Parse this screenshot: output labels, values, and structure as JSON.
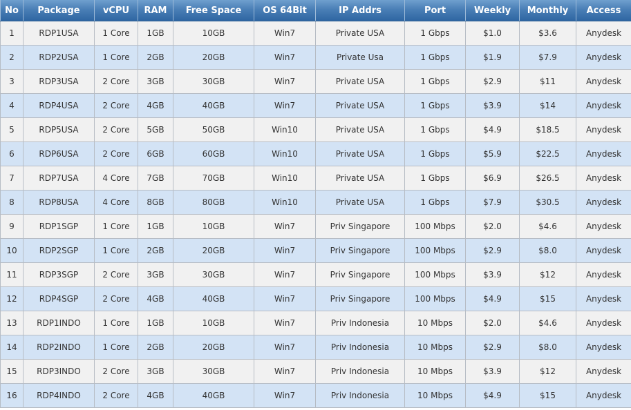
{
  "colors": {
    "header_bg": "#4a7fb6",
    "header_text": "#ffffff",
    "row_odd": "#f1f1f1",
    "row_even": "#d3e3f5",
    "border": "#b6bcc4"
  },
  "table": {
    "headers": [
      "No",
      "Package",
      "vCPU",
      "RAM",
      "Free Space",
      "OS 64Bit",
      "IP Addrs",
      "Port",
      "Weekly",
      "Monthly",
      "Access"
    ],
    "rows": [
      [
        "1",
        "RDP1USA",
        "1 Core",
        "1GB",
        "10GB",
        "Win7",
        "Private USA",
        "1 Gbps",
        "$1.0",
        "$3.6",
        "Anydesk"
      ],
      [
        "2",
        "RDP2USA",
        "1 Core",
        "2GB",
        "20GB",
        "Win7",
        "Private Usa",
        "1 Gbps",
        "$1.9",
        "$7.9",
        "Anydesk"
      ],
      [
        "3",
        "RDP3USA",
        "2 Core",
        "3GB",
        "30GB",
        "Win7",
        "Private USA",
        "1 Gbps",
        "$2.9",
        "$11",
        "Anydesk"
      ],
      [
        "4",
        "RDP4USA",
        "2 Core",
        "4GB",
        "40GB",
        "Win7",
        "Private USA",
        "1 Gbps",
        "$3.9",
        "$14",
        "Anydesk"
      ],
      [
        "5",
        "RDP5USA",
        "2 Core",
        "5GB",
        "50GB",
        "Win10",
        "Private USA",
        "1 Gbps",
        "$4.9",
        "$18.5",
        "Anydesk"
      ],
      [
        "6",
        "RDP6USA",
        "2 Core",
        "6GB",
        "60GB",
        "Win10",
        "Private USA",
        "1 Gbps",
        "$5.9",
        "$22.5",
        "Anydesk"
      ],
      [
        "7",
        "RDP7USA",
        "4 Core",
        "7GB",
        "70GB",
        "Win10",
        "Private USA",
        "1 Gbps",
        "$6.9",
        "$26.5",
        "Anydesk"
      ],
      [
        "8",
        "RDP8USA",
        "4 Core",
        "8GB",
        "80GB",
        "Win10",
        "Private USA",
        "1 Gbps",
        "$7.9",
        "$30.5",
        "Anydesk"
      ],
      [
        "9",
        "RDP1SGP",
        "1 Core",
        "1GB",
        "10GB",
        "Win7",
        "Priv Singapore",
        "100 Mbps",
        "$2.0",
        "$4.6",
        "Anydesk"
      ],
      [
        "10",
        "RDP2SGP",
        "1 Core",
        "2GB",
        "20GB",
        "Win7",
        "Priv Singapore",
        "100 Mbps",
        "$2.9",
        "$8.0",
        "Anydesk"
      ],
      [
        "11",
        "RDP3SGP",
        "2 Core",
        "3GB",
        "30GB",
        "Win7",
        "Priv Singapore",
        "100 Mbps",
        "$3.9",
        "$12",
        "Anydesk"
      ],
      [
        "12",
        "RDP4SGP",
        "2 Core",
        "4GB",
        "40GB",
        "Win7",
        "Priv Singapore",
        "100 Mbps",
        "$4.9",
        "$15",
        "Anydesk"
      ],
      [
        "13",
        "RDP1INDO",
        "1 Core",
        "1GB",
        "10GB",
        "Win7",
        "Priv Indonesia",
        "10 Mbps",
        "$2.0",
        "$4.6",
        "Anydesk"
      ],
      [
        "14",
        "RDP2INDO",
        "1 Core",
        "2GB",
        "20GB",
        "Win7",
        "Priv Indonesia",
        "10 Mbps",
        "$2.9",
        "$8.0",
        "Anydesk"
      ],
      [
        "15",
        "RDP3INDO",
        "2 Core",
        "3GB",
        "30GB",
        "Win7",
        "Priv Indonesia",
        "10 Mbps",
        "$3.9",
        "$12",
        "Anydesk"
      ],
      [
        "16",
        "RDP4INDO",
        "2 Core",
        "4GB",
        "40GB",
        "Win7",
        "Priv Indonesia",
        "10 Mbps",
        "$4.9",
        "$15",
        "Anydesk"
      ]
    ]
  }
}
